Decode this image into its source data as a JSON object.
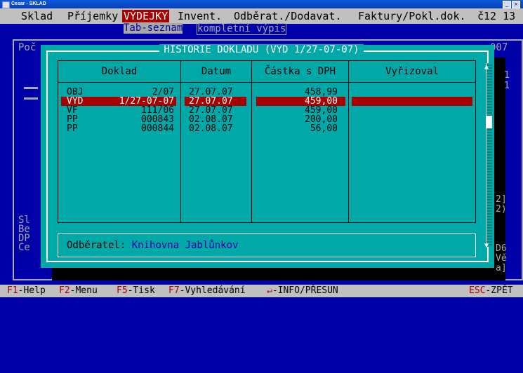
{
  "window": {
    "title": "Cesar - SKLAD"
  },
  "menubar": {
    "items": [
      "Sklad",
      "Příjemky",
      "VÝDEJKY",
      "Invent.",
      "Odběrat./Dodavat.",
      "Faktury/Pokl.dok."
    ],
    "right": "č12 13"
  },
  "submenu": {
    "tab_seznam": "Tab-seznam",
    "kompletni": "kompletní výpis"
  },
  "background": {
    "poc": "Poč",
    "right007": "007",
    "left_labels": "Sl\nBe\nDP\nCe",
    "right_digits": "1\n1",
    "right_digits2": "2]\n2)\n\n\n\nD6\nVě\na]"
  },
  "dialog": {
    "title": "HISTORIE DOKLADU (VYD 1/27-07-07)",
    "columns": [
      "Doklad",
      "Datum",
      "Částka s DPH",
      "Vyřizoval"
    ],
    "rows": [
      {
        "type": "OBJ",
        "num": "2/07",
        "date": "27.07.07",
        "amount": "458,99",
        "by": ""
      },
      {
        "type": "VYD",
        "num": "1/27-07-07",
        "date": "27.07.07",
        "amount": "459,00",
        "by": "",
        "selected": true
      },
      {
        "type": "VF",
        "num": "111/06",
        "date": "27.07.07",
        "amount": "459,00",
        "by": ""
      },
      {
        "type": "PP",
        "num": "000843",
        "date": "02.08.07",
        "amount": "200,00",
        "by": ""
      },
      {
        "type": "PP",
        "num": "000844",
        "date": "02.08.07",
        "amount": "56,00",
        "by": ""
      }
    ],
    "customer_label": "Odběratel:",
    "customer_value": "Knihovna Jablůnkov"
  },
  "statusbar": {
    "f1": "F1",
    "f1_label": "-Help",
    "f2": "F2",
    "f2_label": "-Menu",
    "f5": "F5",
    "f5_label": "-Tisk",
    "f7": "F7",
    "f7_label": "-Vyhledávání",
    "enter": "↵",
    "enter_label": "-INFO/PŘESUN",
    "esc": "ESC",
    "esc_label": "-ZPĚT"
  },
  "colors": {
    "menu_highlight": "#a80000",
    "dialog_bg": "#00a8a8",
    "screen_bg": "#0000a8"
  }
}
